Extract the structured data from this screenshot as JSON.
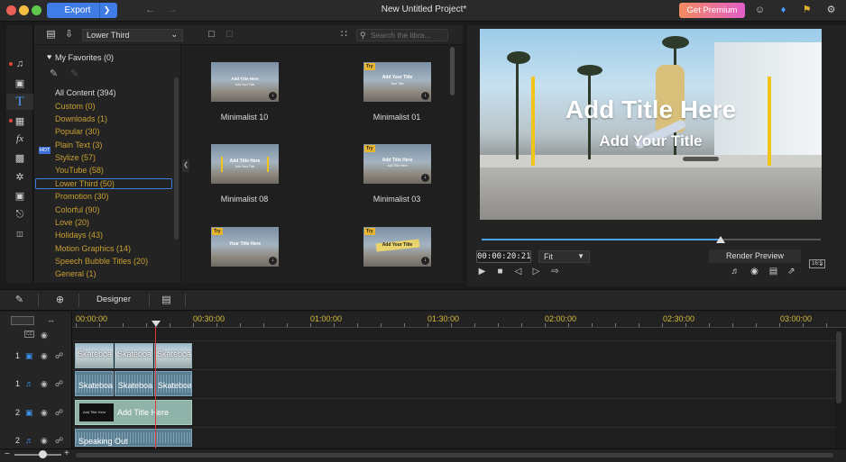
{
  "titlebar": {
    "export_label": "Export",
    "project_title": "New Untitled Project*",
    "premium_label": "Get Premium"
  },
  "library": {
    "category_selected": "Lower Third",
    "search_placeholder": "Search the libra...",
    "favorites_label": "My Favorites (0)",
    "hot_badge": "HOT",
    "categories": [
      {
        "label": "All Content (394)"
      },
      {
        "label": "Custom (0)"
      },
      {
        "label": "Downloads (1)"
      },
      {
        "label": "Popular (30)"
      },
      {
        "label": "Plain Text (3)"
      },
      {
        "label": "Stylize (57)"
      },
      {
        "label": "YouTube (58)"
      },
      {
        "label": "Lower Third (50)"
      },
      {
        "label": "Promotion (30)"
      },
      {
        "label": "Colorful (90)"
      },
      {
        "label": "Love (20)"
      },
      {
        "label": "Holidays (43)"
      },
      {
        "label": "Motion Graphics (14)"
      },
      {
        "label": "Speech Bubble Titles (20)"
      },
      {
        "label": "General (1)"
      }
    ],
    "templates": [
      {
        "name": "Minimalist 10",
        "t1": "Add Title Here",
        "t2": "Add Your Title",
        "try": ""
      },
      {
        "name": "Minimalist 01",
        "t1": "Add Your Title",
        "t2": "Your Title",
        "try": "Try"
      },
      {
        "name": "Minimalist 08",
        "t1": "Add Title Here",
        "t2": "Add Your Title",
        "try": ""
      },
      {
        "name": "Minimalist 03",
        "t1": "Add Title Here",
        "t2": "Add Title Here",
        "try": "Try"
      },
      {
        "name": "",
        "t1": "Your Title Here",
        "t2": "",
        "try": "Try"
      },
      {
        "name": "",
        "t1": "Add Your Title",
        "t2": "",
        "try": "Try"
      }
    ]
  },
  "preview": {
    "overlay_title": "Add Title Here",
    "overlay_subtitle": "Add Your Title",
    "timecode": "00:00:20:21",
    "fit_label": "Fit",
    "render_label": "Render Preview",
    "ratio_label": "16:9",
    "progress_fraction": 0.705
  },
  "timeline": {
    "designer_label": "Designer",
    "ruler": [
      "00:00:00",
      "00:30:00",
      "01:00:00",
      "01:30:00",
      "02:00:00",
      "02:30:00",
      "03:00:00"
    ],
    "tracks": [
      {
        "num": "1"
      },
      {
        "num": "1"
      },
      {
        "num": "2"
      },
      {
        "num": "2"
      }
    ],
    "clips": {
      "video_clip": "Skateboa",
      "audio_clip": "Skateboa",
      "title_clip": "Add Title Here",
      "title_mini": "Add Title Here",
      "speaking_clip": "Speaking Out"
    },
    "cc_label": "CC"
  },
  "colors": {
    "accent_blue": "#3f7ce6",
    "category_gold": "#c9a032",
    "playhead_red": "#e03a3a",
    "overlay_bar_yellow": "#f0c419"
  }
}
